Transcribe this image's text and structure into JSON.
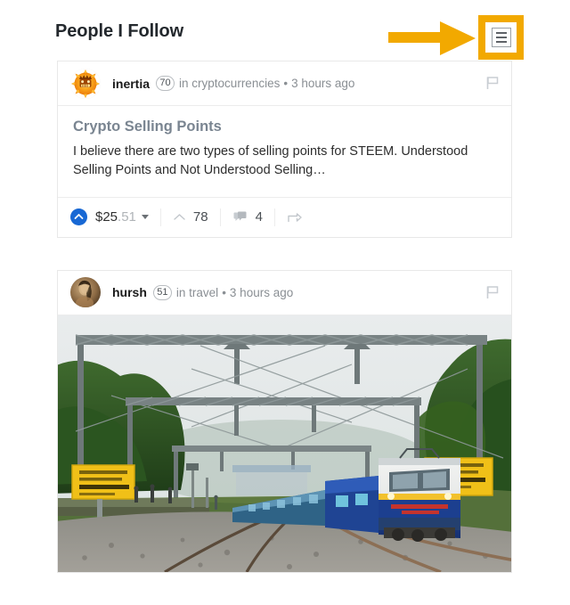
{
  "header": {
    "title": "People I Follow",
    "menu_button_label": "list-view-toggle",
    "highlight_color": "#F2A900",
    "arrow_color": "#F2A900"
  },
  "posts": [
    {
      "author": "inertia",
      "reputation": "70",
      "in_label": "in",
      "category": "cryptocurrencies",
      "separator": "•",
      "time": "3 hours ago",
      "title": "Crypto Selling Points",
      "summary": "I believe there are two types of selling points for STEEM. Understood Selling Points and Not Understood Selling…",
      "payout_whole": "$25",
      "payout_cents": ".51",
      "votes": "78",
      "comments": "4",
      "upvote_color": "#1868d4",
      "flag_label": "flag-post",
      "has_image": false
    },
    {
      "author": "hursh",
      "reputation": "51",
      "in_label": "in",
      "category": "travel",
      "separator": "•",
      "time": "3 hours ago",
      "flag_label": "flag-post",
      "has_image": true,
      "image_alt": "Indian Railways passenger train approaching on curved tracks with overhead electric catenary and yellow station signboards"
    }
  ]
}
